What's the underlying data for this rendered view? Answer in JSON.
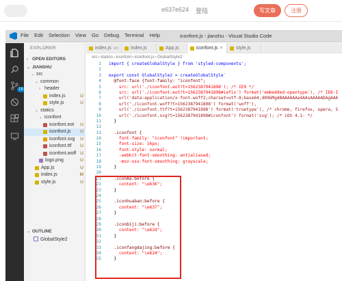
{
  "web_header": {
    "username": "e637e624",
    "login_label": "登陆",
    "write_label": "写文章",
    "register_label": "注册"
  },
  "vscode": {
    "menu": [
      "File",
      "Edit",
      "Selection",
      "View",
      "Go",
      "Debug",
      "Terminal",
      "Help"
    ],
    "window_title": "iconfont.js - jianshu - Visual Studio Code",
    "activity_badge": "18",
    "sidebar": {
      "explorer_label": "EXPLORER",
      "open_editors_label": "OPEN EDITORS",
      "project_label": "JIANSHU",
      "tree": [
        {
          "label": "src",
          "indent": 1,
          "chevron": "⌄",
          "icon": "",
          "status": ""
        },
        {
          "label": "common",
          "indent": 2,
          "chevron": "⌄",
          "icon": "",
          "status": ""
        },
        {
          "label": "header",
          "indent": 3,
          "chevron": "›",
          "icon": "",
          "status": ""
        },
        {
          "label": "index.js",
          "indent": 4,
          "chevron": "",
          "icon": "js",
          "status": "U"
        },
        {
          "label": "style.js",
          "indent": 4,
          "chevron": "",
          "icon": "js",
          "status": "U"
        },
        {
          "label": "statics",
          "indent": 2,
          "chevron": "⌄",
          "icon": "",
          "status": ""
        },
        {
          "label": "iconfont",
          "indent": 3,
          "chevron": "⌄",
          "icon": "",
          "status": ""
        },
        {
          "label": "iconfont.eot",
          "indent": 4,
          "chevron": "",
          "icon": "font",
          "status": "U"
        },
        {
          "label": "iconfont.js",
          "indent": 4,
          "chevron": "",
          "icon": "js",
          "status": "U"
        },
        {
          "label": "iconfont.svg",
          "indent": 4,
          "chevron": "",
          "icon": "svg",
          "status": "U"
        },
        {
          "label": "iconfont.ttf",
          "indent": 4,
          "chevron": "",
          "icon": "font",
          "status": "U"
        },
        {
          "label": "iconfont.woff",
          "indent": 4,
          "chevron": "",
          "icon": "font",
          "status": "U"
        },
        {
          "label": "logo.png",
          "indent": 3,
          "chevron": "",
          "icon": "img",
          "status": "U"
        },
        {
          "label": "App.js",
          "indent": 2,
          "chevron": "",
          "icon": "js",
          "status": "U"
        },
        {
          "label": "index.js",
          "indent": 2,
          "chevron": "",
          "icon": "js",
          "status": "M"
        },
        {
          "label": "style.js",
          "indent": 2,
          "chevron": "",
          "icon": "js",
          "status": "U"
        }
      ],
      "outline_label": "OUTLINE",
      "outline_item": "GlobalStyle2"
    },
    "tabs": [
      {
        "label": "index.js",
        "dir": "src",
        "active": false,
        "icon": "js"
      },
      {
        "label": "index.js",
        "dir": "",
        "active": false,
        "icon": "js"
      },
      {
        "label": "App.js",
        "dir": "",
        "active": false,
        "icon": "js"
      },
      {
        "label": "iconfont.js",
        "dir": "",
        "active": true,
        "icon": "js",
        "close": "×"
      },
      {
        "label": "style.js",
        "dir": "",
        "active": false,
        "icon": "js"
      }
    ],
    "breadcrumb": [
      "src",
      "›",
      "statics",
      "›",
      "iconfont",
      "›",
      "iconfont.js",
      "›",
      "GlobalStyle2"
    ],
    "code_lines": [
      {
        "n": "1",
        "text": "import { createGlobalStyle } from 'styled-components';",
        "cls": "kw"
      },
      {
        "n": "2",
        "text": "",
        "cls": ""
      },
      {
        "n": "3",
        "text": "export const GlobalStyle2 = createGlobalStyle`",
        "cls": "kw"
      },
      {
        "n": "4",
        "text": "  @font-face {font-family: \"iconfont\";",
        "cls": "sel"
      },
      {
        "n": "5",
        "text": "    src: url('./iconfont.eot?t=1562387941898'); /* IE9 */",
        "cls": "prop"
      },
      {
        "n": "6",
        "text": "    src: url('./iconfont.eot?t=1562387941898#iefix') format('embedded-opentype'), /* IE6-I",
        "cls": "prop"
      },
      {
        "n": "7",
        "text": "    url('data:application/x-font-woff2;charset=utf-8;base64,d09GMgABAAAAAAa4AAsAAAAADAgAAA",
        "cls": "str"
      },
      {
        "n": "8",
        "text": "    url('./iconfont.woff?t=1562387941898') format('woff'),",
        "cls": "str"
      },
      {
        "n": "9",
        "text": "    url('./iconfont.ttf?t=1562387941898') format('truetype'), /* chrome, firefox, opera, S",
        "cls": "str"
      },
      {
        "n": "10",
        "text": "    url('./iconfont.svg?t=1562387941898#iconfont') format('svg'); /* iOS 4.1- */",
        "cls": "str"
      },
      {
        "n": "11",
        "text": "  }",
        "cls": "punc"
      },
      {
        "n": "12",
        "text": "",
        "cls": ""
      },
      {
        "n": "13",
        "text": "  .iconfont {",
        "cls": "sel"
      },
      {
        "n": "14",
        "text": "    font-family: \"iconfont\" !important;",
        "cls": "prop"
      },
      {
        "n": "15",
        "text": "    font-size: 16px;",
        "cls": "prop"
      },
      {
        "n": "16",
        "text": "    font-style: normal;",
        "cls": "prop"
      },
      {
        "n": "17",
        "text": "    -webkit-font-smoothing: antialiased;",
        "cls": "prop"
      },
      {
        "n": "18",
        "text": "    -moz-osx-font-smoothing: grayscale;",
        "cls": "prop"
      },
      {
        "n": "19",
        "text": "  }",
        "cls": "punc"
      },
      {
        "n": "20",
        "text": "",
        "cls": ""
      },
      {
        "n": "21",
        "text": "  .iconAa:before {",
        "cls": "sel"
      },
      {
        "n": "22",
        "text": "    content: \"\\e636\";",
        "cls": "prop"
      },
      {
        "n": "23",
        "text": "  }",
        "cls": "punc"
      },
      {
        "n": "24",
        "text": "",
        "cls": ""
      },
      {
        "n": "25",
        "text": "  .iconhuaban:before {",
        "cls": "sel"
      },
      {
        "n": "26",
        "text": "    content: \"\\e637\";",
        "cls": "prop"
      },
      {
        "n": "27",
        "text": "  }",
        "cls": "punc"
      },
      {
        "n": "28",
        "text": "",
        "cls": ""
      },
      {
        "n": "29",
        "text": "  .iconbiji:before {",
        "cls": "sel"
      },
      {
        "n": "30",
        "text": "    content: \"\\e62d\";",
        "cls": "prop"
      },
      {
        "n": "31",
        "text": "  }",
        "cls": "punc"
      },
      {
        "n": "32",
        "text": "",
        "cls": ""
      },
      {
        "n": "33",
        "text": "  .iconfangdajing:before {",
        "cls": "sel"
      },
      {
        "n": "34",
        "text": "    content: \"\\e624\";",
        "cls": "prop"
      },
      {
        "n": "35",
        "text": "  }",
        "cls": "punc"
      }
    ]
  },
  "colors": {
    "brand": "#ea6f5a",
    "vscode_accent": "#007acc",
    "annotation": "#e0261f"
  }
}
